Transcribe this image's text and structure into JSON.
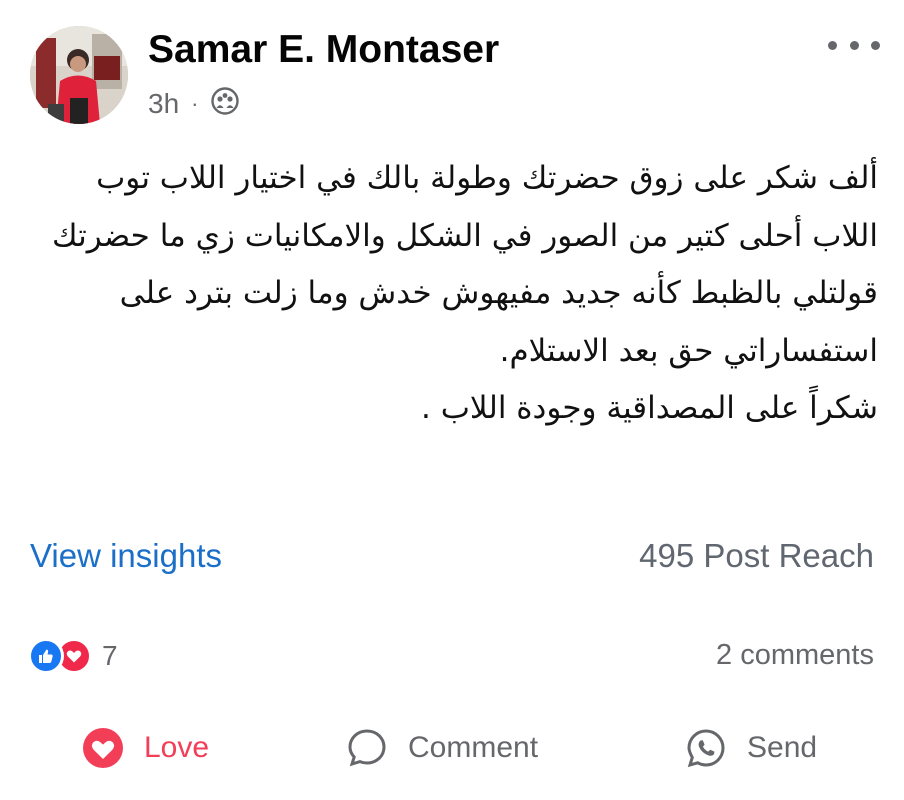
{
  "post": {
    "author": "Samar E. Montaser",
    "time": "3h",
    "separator": "·",
    "audience_icon": "friends-icon",
    "more_icon": "more-horizontal-icon",
    "text": "ألف شكر على زوق حضرتك وطولة بالك في اختيار اللاب توب\nاللاب أحلى كتير من الصور في الشكل والامكانيات زي ما حضرتك قولتلي بالظبط كأنه جديد مفيهوش خدش وما زلت بترد على استفساراتي حق بعد الاستلام.\nشكراً على المصداقية وجودة اللاب ."
  },
  "insights": {
    "link": "View insights",
    "reach": "495 Post Reach"
  },
  "reactions": {
    "icons": [
      "like-icon",
      "love-icon"
    ],
    "count": "7",
    "comments": "2 comments"
  },
  "actions": {
    "love": "Love",
    "comment": "Comment",
    "send": "Send"
  },
  "colors": {
    "link_blue": "#1b6fc8",
    "love_red": "#f33e58",
    "like_blue": "#1877f2",
    "muted_gray": "#65676b"
  }
}
